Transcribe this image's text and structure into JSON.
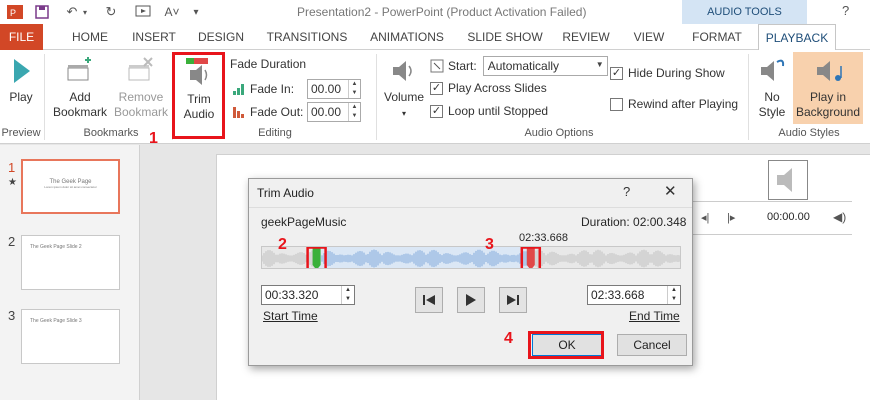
{
  "window": {
    "title": "Presentation2 - PowerPoint (Product Activation Failed)",
    "contextual_group": "AUDIO TOOLS",
    "help": "?"
  },
  "tabs": [
    "FILE",
    "HOME",
    "INSERT",
    "DESIGN",
    "TRANSITIONS",
    "ANIMATIONS",
    "SLIDE SHOW",
    "REVIEW",
    "VIEW",
    "FORMAT",
    "PLAYBACK"
  ],
  "active_tab": "PLAYBACK",
  "ribbon": {
    "preview": {
      "play_label": "Play",
      "group_label": "Preview"
    },
    "bookmarks": {
      "add_line1": "Add",
      "add_line2": "Bookmark",
      "remove_line1": "Remove",
      "remove_line2": "Bookmark",
      "group_label": "Bookmarks"
    },
    "editing": {
      "trim_line1": "Trim",
      "trim_line2": "Audio",
      "fade_duration_label": "Fade Duration",
      "fade_in_label": "Fade In:",
      "fade_in_value": "00.00",
      "fade_out_label": "Fade Out:",
      "fade_out_value": "00.00",
      "group_label": "Editing"
    },
    "audio_options": {
      "volume_label": "Volume",
      "start_label": "Start:",
      "start_value": "Automatically",
      "play_across_slides": "Play Across Slides",
      "play_across_checked": true,
      "loop_until_stopped": "Loop until Stopped",
      "loop_checked": true,
      "hide_during_show": "Hide During Show",
      "hide_checked": true,
      "rewind_after_playing": "Rewind after Playing",
      "rewind_checked": false,
      "group_label": "Audio Options"
    },
    "audio_styles": {
      "no_style_line1": "No",
      "no_style_line2": "Style",
      "play_bg_line1": "Play in",
      "play_bg_line2": "Background",
      "group_label": "Audio Styles"
    }
  },
  "slides": [
    {
      "number": "1",
      "title": "The Geek Page",
      "subtitle": "Lorem ipsum dolor sit amet consectetur",
      "star": "★"
    },
    {
      "number": "2",
      "title": "The Geek Page Slide 2"
    },
    {
      "number": "3",
      "title": "The Geek Page Slide 3"
    }
  ],
  "player": {
    "time": "00:00.00"
  },
  "dialog": {
    "title": "Trim Audio",
    "file_name": "geekPageMusic",
    "duration": "Duration: 02:00.348",
    "end_marker_time": "02:33.668",
    "start_time_value": "00:33.320",
    "end_time_value": "02:33.668",
    "start_time_label": "Start Time",
    "end_time_label": "End Time",
    "ok_label": "OK",
    "cancel_label": "Cancel",
    "start_marker_fraction": 0.13,
    "end_marker_fraction": 0.64
  },
  "annotations": [
    "1",
    "2",
    "3",
    "4"
  ],
  "colors": {
    "file_tab": "#d24726",
    "highlight": "#e8141b",
    "start_marker": "#3ab03a",
    "end_marker": "#e04848",
    "wave_selected": "#8fb4e0"
  }
}
